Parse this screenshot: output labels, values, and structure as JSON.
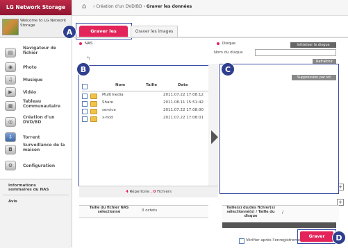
{
  "sidebar": {
    "brand": "LG Network Storage",
    "welcome": "Welcome to LG Network Storage",
    "items": [
      {
        "label": "Navigateur de fichier",
        "icon": "folder-browser-icon"
      },
      {
        "label": "Photo",
        "icon": "camera-icon"
      },
      {
        "label": "Musique",
        "icon": "music-icon"
      },
      {
        "label": "Vidéo",
        "icon": "video-camera-icon"
      },
      {
        "label": "Tableau Communautaire",
        "icon": "board-icon"
      },
      {
        "label": "Création d'un DVD/BD",
        "icon": "disc-icon"
      },
      {
        "label": "Torrent",
        "icon": "torrent-icon"
      },
      {
        "label": "Surveillance de la maison",
        "icon": "cctv-icon"
      },
      {
        "label": "Configuration",
        "icon": "gear-icon"
      }
    ],
    "summary_label": "Informations sommaires du NAS",
    "notice_label": "Avis"
  },
  "breadcrumb": {
    "parent": "Création d'un DVD/BD",
    "current": "Graver les données"
  },
  "tabs": {
    "burn_data": "Graver les données",
    "burn_images": "Graver les images"
  },
  "callouts": {
    "a": "A",
    "b": "B",
    "c": "C",
    "d": "D"
  },
  "nas": {
    "label": "NAS",
    "columns": {
      "name": "Nom",
      "size": "Taille",
      "date": "Date"
    },
    "rows": [
      {
        "name": "Multimedia",
        "date": "2011.07.22 17:08:12"
      },
      {
        "name": "Share",
        "date": "2011.08.11 15:51:42"
      },
      {
        "name": "service",
        "date": "2011.07.22 17:08:00"
      },
      {
        "name": "x-hdd",
        "date": "2011.07.22 17:08:01"
      }
    ],
    "dir_count": "4",
    "dir_label": "Répertoire ,",
    "file_count": "0",
    "file_label": "Fichiers",
    "size_label": "Taille du fichier NAS sélectionné",
    "size_value": "0 octets"
  },
  "disk": {
    "label": "Disque",
    "init_button": "Initialiser le disque",
    "name_label": "Nom du disque",
    "name_value": "",
    "refresh_button": "Rafraîchir",
    "delete_batch_button": "Suppression par lot",
    "size_label": "Taille(s) du/des fichier(s) sélectionné(s) / Taille du disque",
    "size_value": "/"
  },
  "footer": {
    "verify_label": "Vérifier après l'enregistrement",
    "burn_button": "Graver"
  },
  "colors": {
    "accent": "#e3245a",
    "callout": "#2e3f8f"
  }
}
